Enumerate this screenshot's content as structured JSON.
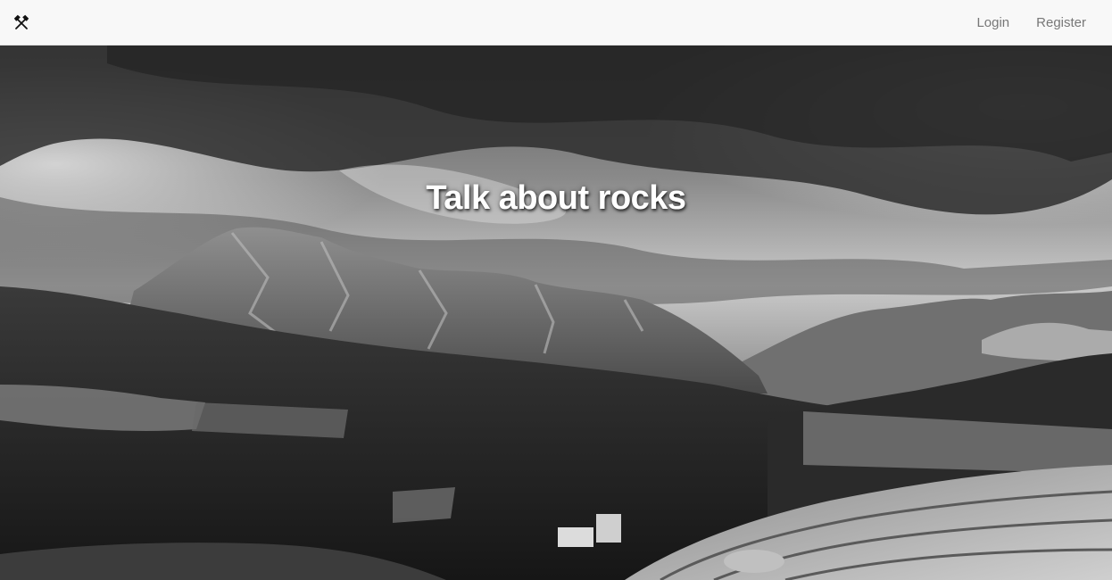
{
  "navbar": {
    "brand_icon": "crossed-hammers-icon",
    "links": [
      {
        "label": "Login"
      },
      {
        "label": "Register"
      }
    ]
  },
  "hero": {
    "title": "Talk about rocks",
    "background": "grayscale-mountain-quarry-photo"
  },
  "colors": {
    "navbar_bg": "#f8f8f8",
    "nav_link": "#777777",
    "hero_title": "#ffffff"
  }
}
